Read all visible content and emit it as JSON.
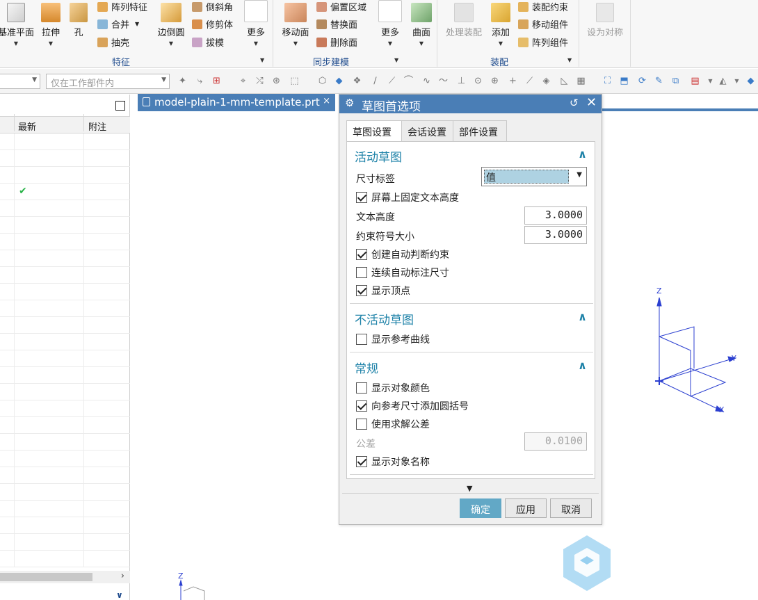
{
  "ribbon": {
    "big_buttons": [
      {
        "label": "基准平面"
      },
      {
        "label": "拉伸"
      },
      {
        "label": "孔"
      },
      {
        "label": "边倒圆"
      },
      {
        "label": "更多"
      },
      {
        "label": "移动面"
      },
      {
        "label": "更多"
      },
      {
        "label": "曲面"
      },
      {
        "label": "处理装配"
      },
      {
        "label": "添加"
      },
      {
        "label": "设为对称"
      }
    ],
    "small_buttons": [
      {
        "label": "阵列特征"
      },
      {
        "label": "合并"
      },
      {
        "label": "抽壳"
      },
      {
        "label": "倒斜角"
      },
      {
        "label": "修剪体"
      },
      {
        "label": "拔模"
      },
      {
        "label": "偏置区域"
      },
      {
        "label": "替换面"
      },
      {
        "label": "删除面"
      },
      {
        "label": "装配约束"
      },
      {
        "label": "移动组件"
      },
      {
        "label": "阵列组件"
      }
    ],
    "groups": [
      {
        "label": "特征"
      },
      {
        "label": "同步建模"
      },
      {
        "label": "装配"
      }
    ]
  },
  "toolbar": {
    "scope_combo": "仅在工作部件内"
  },
  "navigator": {
    "columns": [
      "最新",
      "附注"
    ]
  },
  "document_tab": {
    "label": "model-plain-1-mm-template.prt",
    "close": "×"
  },
  "dialog": {
    "title": "草图首选项",
    "tabs": [
      "草图设置",
      "会话设置",
      "部件设置"
    ],
    "sections": {
      "active_sketch": {
        "title": "活动草图",
        "dimension_label": "尺寸标签",
        "dimension_label_value": "值",
        "fix_text_height": "屏幕上固定文本高度",
        "text_height_label": "文本高度",
        "text_height_value": "3.0000",
        "constraint_size_label": "约束符号大小",
        "constraint_size_value": "3.0000",
        "create_auto_constraints": "创建自动判断约束",
        "continuous_auto_dimension": "连续自动标注尺寸",
        "show_vertices": "显示顶点"
      },
      "inactive_sketch": {
        "title": "不活动草图",
        "show_reference_curves": "显示参考曲线"
      },
      "general": {
        "title": "常规",
        "show_object_color": "显示对象颜色",
        "add_parentheses": "向参考尺寸添加圆括号",
        "use_solve_tolerance": "使用求解公差",
        "tolerance_label": "公差",
        "tolerance_value": "0.0100",
        "show_object_name": "显示对象名称"
      }
    },
    "buttons": {
      "ok": "确定",
      "apply": "应用",
      "cancel": "取消"
    }
  },
  "axes": {
    "z": "Z",
    "y": "Y",
    "x": "X"
  },
  "colors": {
    "title_bar": "#4a7eb6",
    "section_title": "#1e82a8",
    "primary_button": "#62a8c6",
    "axis": "#2b3fd0"
  }
}
